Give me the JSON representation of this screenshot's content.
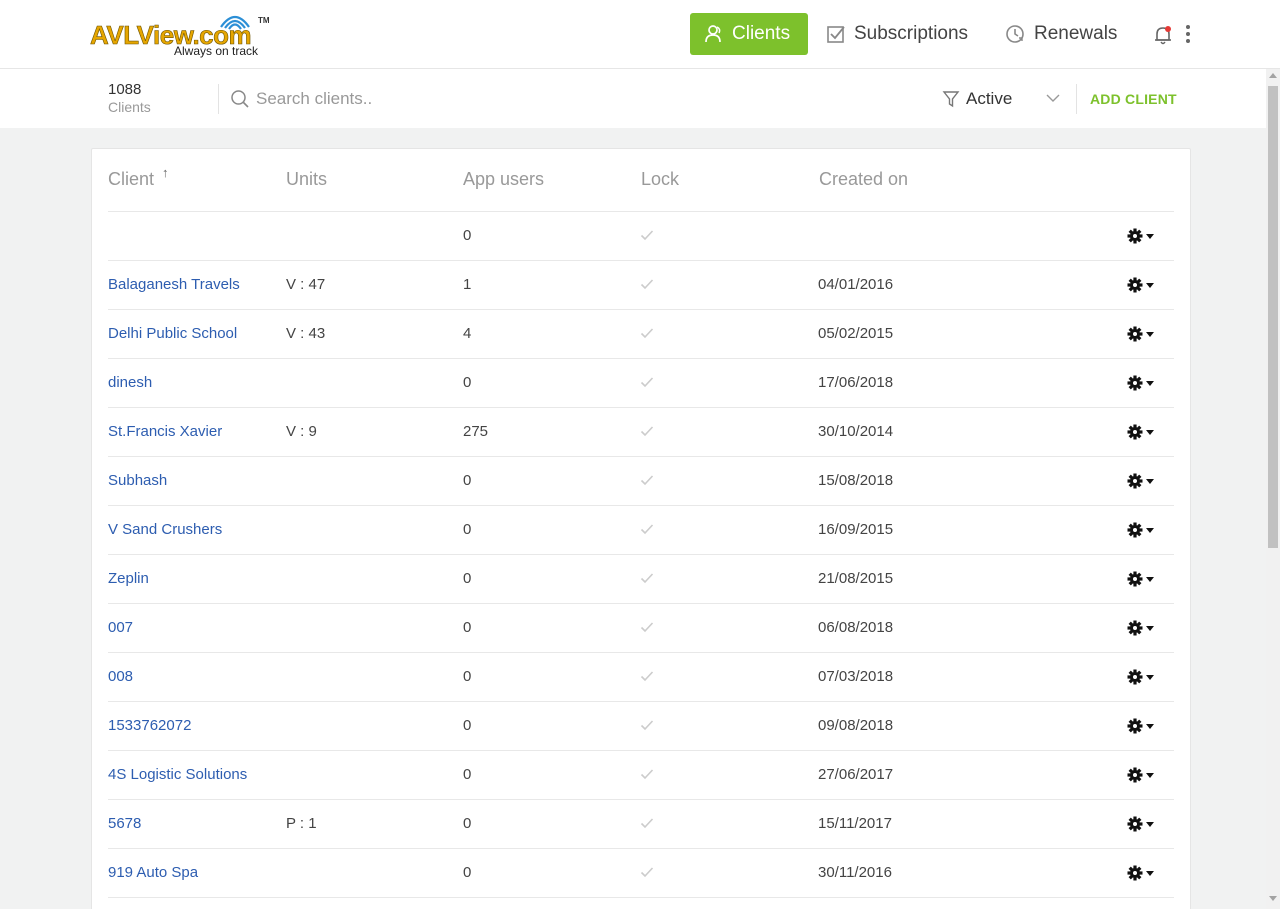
{
  "brand": {
    "name": "AVLView.com",
    "tm": "TM",
    "tagline": "Always on track"
  },
  "nav": {
    "clients": "Clients",
    "subscriptions": "Subscriptions",
    "renewals": "Renewals"
  },
  "toolbar": {
    "count": "1088",
    "count_label": "Clients",
    "search_placeholder": "Search clients..",
    "filter_value": "Active",
    "add_client": "ADD CLIENT"
  },
  "colors": {
    "accent": "#7dc12c",
    "link": "#2d5db0"
  },
  "table": {
    "columns": [
      "Client",
      "Units",
      "App users",
      "Lock",
      "Created on"
    ],
    "sort_indicator": "↑",
    "rows": [
      {
        "client": "",
        "units": "",
        "app_users": "0",
        "created": ""
      },
      {
        "client": "Balaganesh Travels",
        "units": "V : 47",
        "app_users": "1",
        "created": "04/01/2016"
      },
      {
        "client": "Delhi Public School",
        "units": "V : 43",
        "app_users": "4",
        "created": "05/02/2015"
      },
      {
        "client": "dinesh",
        "units": "",
        "app_users": "0",
        "created": "17/06/2018"
      },
      {
        "client": "St.Francis Xavier",
        "units": "V : 9",
        "app_users": "275",
        "created": "30/10/2014"
      },
      {
        "client": "Subhash",
        "units": "",
        "app_users": "0",
        "created": "15/08/2018"
      },
      {
        "client": "V Sand Crushers",
        "units": "",
        "app_users": "0",
        "created": "16/09/2015"
      },
      {
        "client": "Zeplin",
        "units": "",
        "app_users": "0",
        "created": "21/08/2015"
      },
      {
        "client": "007",
        "units": "",
        "app_users": "0",
        "created": "06/08/2018"
      },
      {
        "client": "008",
        "units": "",
        "app_users": "0",
        "created": "07/03/2018"
      },
      {
        "client": "1533762072",
        "units": "",
        "app_users": "0",
        "created": "09/08/2018"
      },
      {
        "client": "4S Logistic Solutions",
        "units": "",
        "app_users": "0",
        "created": "27/06/2017"
      },
      {
        "client": "5678",
        "units": "P : 1",
        "app_users": "0",
        "created": "15/11/2017"
      },
      {
        "client": "919 Auto Spa",
        "units": "",
        "app_users": "0",
        "created": "30/11/2016"
      }
    ]
  }
}
